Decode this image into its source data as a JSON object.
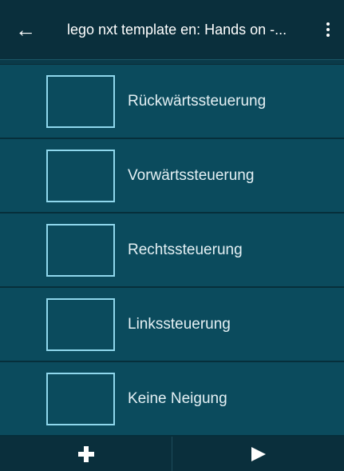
{
  "appbar": {
    "title": "lego nxt template en: Hands on -...",
    "back_icon": "←"
  },
  "items": [
    {
      "label": "Rückwärtssteuerung",
      "checked": false
    },
    {
      "label": "Vorwärtssteuerung",
      "checked": false
    },
    {
      "label": "Rechtssteuerung",
      "checked": false
    },
    {
      "label": "Linkssteuerung",
      "checked": false
    },
    {
      "label": "Keine Neigung",
      "checked": false
    }
  ],
  "bottombar": {
    "add_icon": "plus-icon",
    "play_icon": "play-icon"
  },
  "colors": {
    "background": "#063c4c",
    "appbar": "#0a2f3c",
    "item": "#0b4b5d",
    "checkbox_border": "#8fd7ec"
  }
}
